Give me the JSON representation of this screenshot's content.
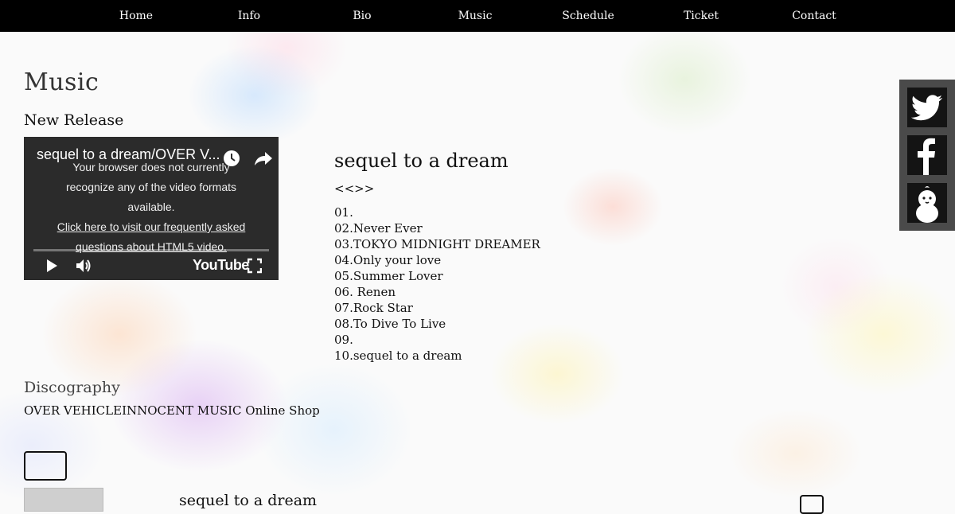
{
  "nav": {
    "items": [
      "Home",
      "Info",
      "Bio",
      "Music",
      "Schedule",
      "Ticket",
      "Contact"
    ]
  },
  "page": {
    "title": "Music",
    "new_release_heading": "New Release"
  },
  "video": {
    "title": "sequel to a dream/OVER V...",
    "message_lines": [
      "Your browser does not currently",
      "recognize any of the video formats",
      "available."
    ],
    "help_link_lines": [
      "Click here to visit our frequently asked",
      "questions about HTML5 video."
    ],
    "brand": "YouTube"
  },
  "album": {
    "title": "sequel to a dream",
    "subtitle": "<<>>",
    "tracks": [
      "01.",
      "02.Never Ever",
      "03.TOKYO MIDNIGHT DREAMER",
      "04.Only your love",
      "05.Summer Lover",
      "06. Renen",
      "07.Rock Star",
      "08.To Dive To Live",
      "09.",
      "10.sequel to a dream"
    ]
  },
  "discography": {
    "heading": "Discography",
    "links": [
      "OVER VEHICLE",
      "INNOCENT MUSIC Online Shop"
    ],
    "item_title": "sequel to a dream"
  },
  "social": {
    "icons": [
      "twitter-icon",
      "facebook-icon",
      "blog-mascot-icon"
    ]
  }
}
